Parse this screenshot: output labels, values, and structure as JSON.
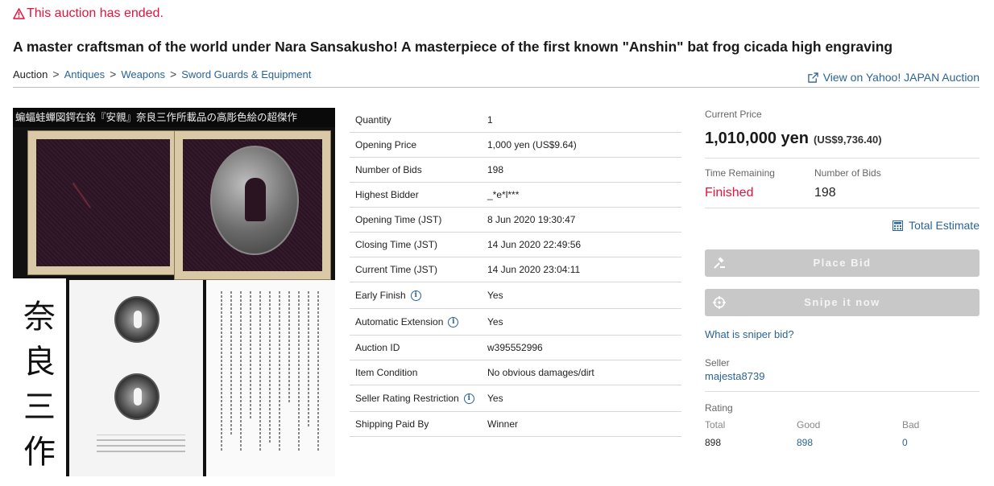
{
  "notice": "This auction has ended.",
  "title": "A master craftsman of the world under Nara Sansakusho! A masterpiece of the first known \"Anshin\" bat frog cicada high engraving",
  "breadcrumb": {
    "root": "Auction",
    "items": [
      "Antiques",
      "Weapons",
      "Sword Guards & Equipment"
    ],
    "separator": ">"
  },
  "view_yahoo": "View on Yahoo! JAPAN Auction",
  "photo": {
    "banner": "蝙蝠蛙蟬図鍔在銘『安親』奈良三作所載品の高彫色絵の超傑作",
    "vertical_text": [
      "奈",
      "良",
      "三",
      "作"
    ]
  },
  "details": [
    {
      "label": "Quantity",
      "value": "1",
      "info": false
    },
    {
      "label": "Opening Price",
      "value": "1,000 yen (US$9.64)",
      "info": false
    },
    {
      "label": "Number of Bids",
      "value": "198",
      "info": false
    },
    {
      "label": "Highest Bidder",
      "value": "_*e*l***",
      "info": false
    },
    {
      "label": "Opening Time (JST)",
      "value": "8 Jun 2020 19:30:47",
      "info": false
    },
    {
      "label": "Closing Time (JST)",
      "value": "14 Jun 2020 22:49:56",
      "info": false
    },
    {
      "label": "Current Time (JST)",
      "value": "14 Jun 2020 23:04:11",
      "info": false
    },
    {
      "label": "Early Finish",
      "value": "Yes",
      "info": true
    },
    {
      "label": "Automatic Extension",
      "value": "Yes",
      "info": true
    },
    {
      "label": "Auction ID",
      "value": "w395552996",
      "info": false
    },
    {
      "label": "Item Condition",
      "value": "No obvious damages/dirt",
      "info": false
    },
    {
      "label": "Seller Rating Restriction",
      "value": "Yes",
      "info": true
    },
    {
      "label": "Shipping Paid By",
      "value": "Winner",
      "info": false
    }
  ],
  "panel": {
    "current_price_label": "Current Price",
    "current_price": "1,010,000 yen",
    "current_price_usd": "(US$9,736.40)",
    "time_remaining_label": "Time Remaining",
    "time_remaining": "Finished",
    "bids_label": "Number of Bids",
    "bids": "198",
    "total_estimate": "Total Estimate",
    "place_bid": "Place Bid",
    "snipe": "Snipe it now",
    "sniper_link": "What is sniper bid?",
    "seller_label": "Seller",
    "seller": "majesta8739",
    "rating_label": "Rating",
    "rating": {
      "total_label": "Total",
      "total": "898",
      "good_label": "Good",
      "good": "898",
      "bad_label": "Bad",
      "bad": "0"
    }
  },
  "colors": {
    "accent_link": "#2a6496",
    "alert_red": "#e0143c",
    "disabled_button": "#c8c8c8"
  },
  "icons": [
    "warning-icon",
    "external-link-icon",
    "info-icon",
    "calculator-icon",
    "gavel-icon",
    "crosshair-icon"
  ]
}
